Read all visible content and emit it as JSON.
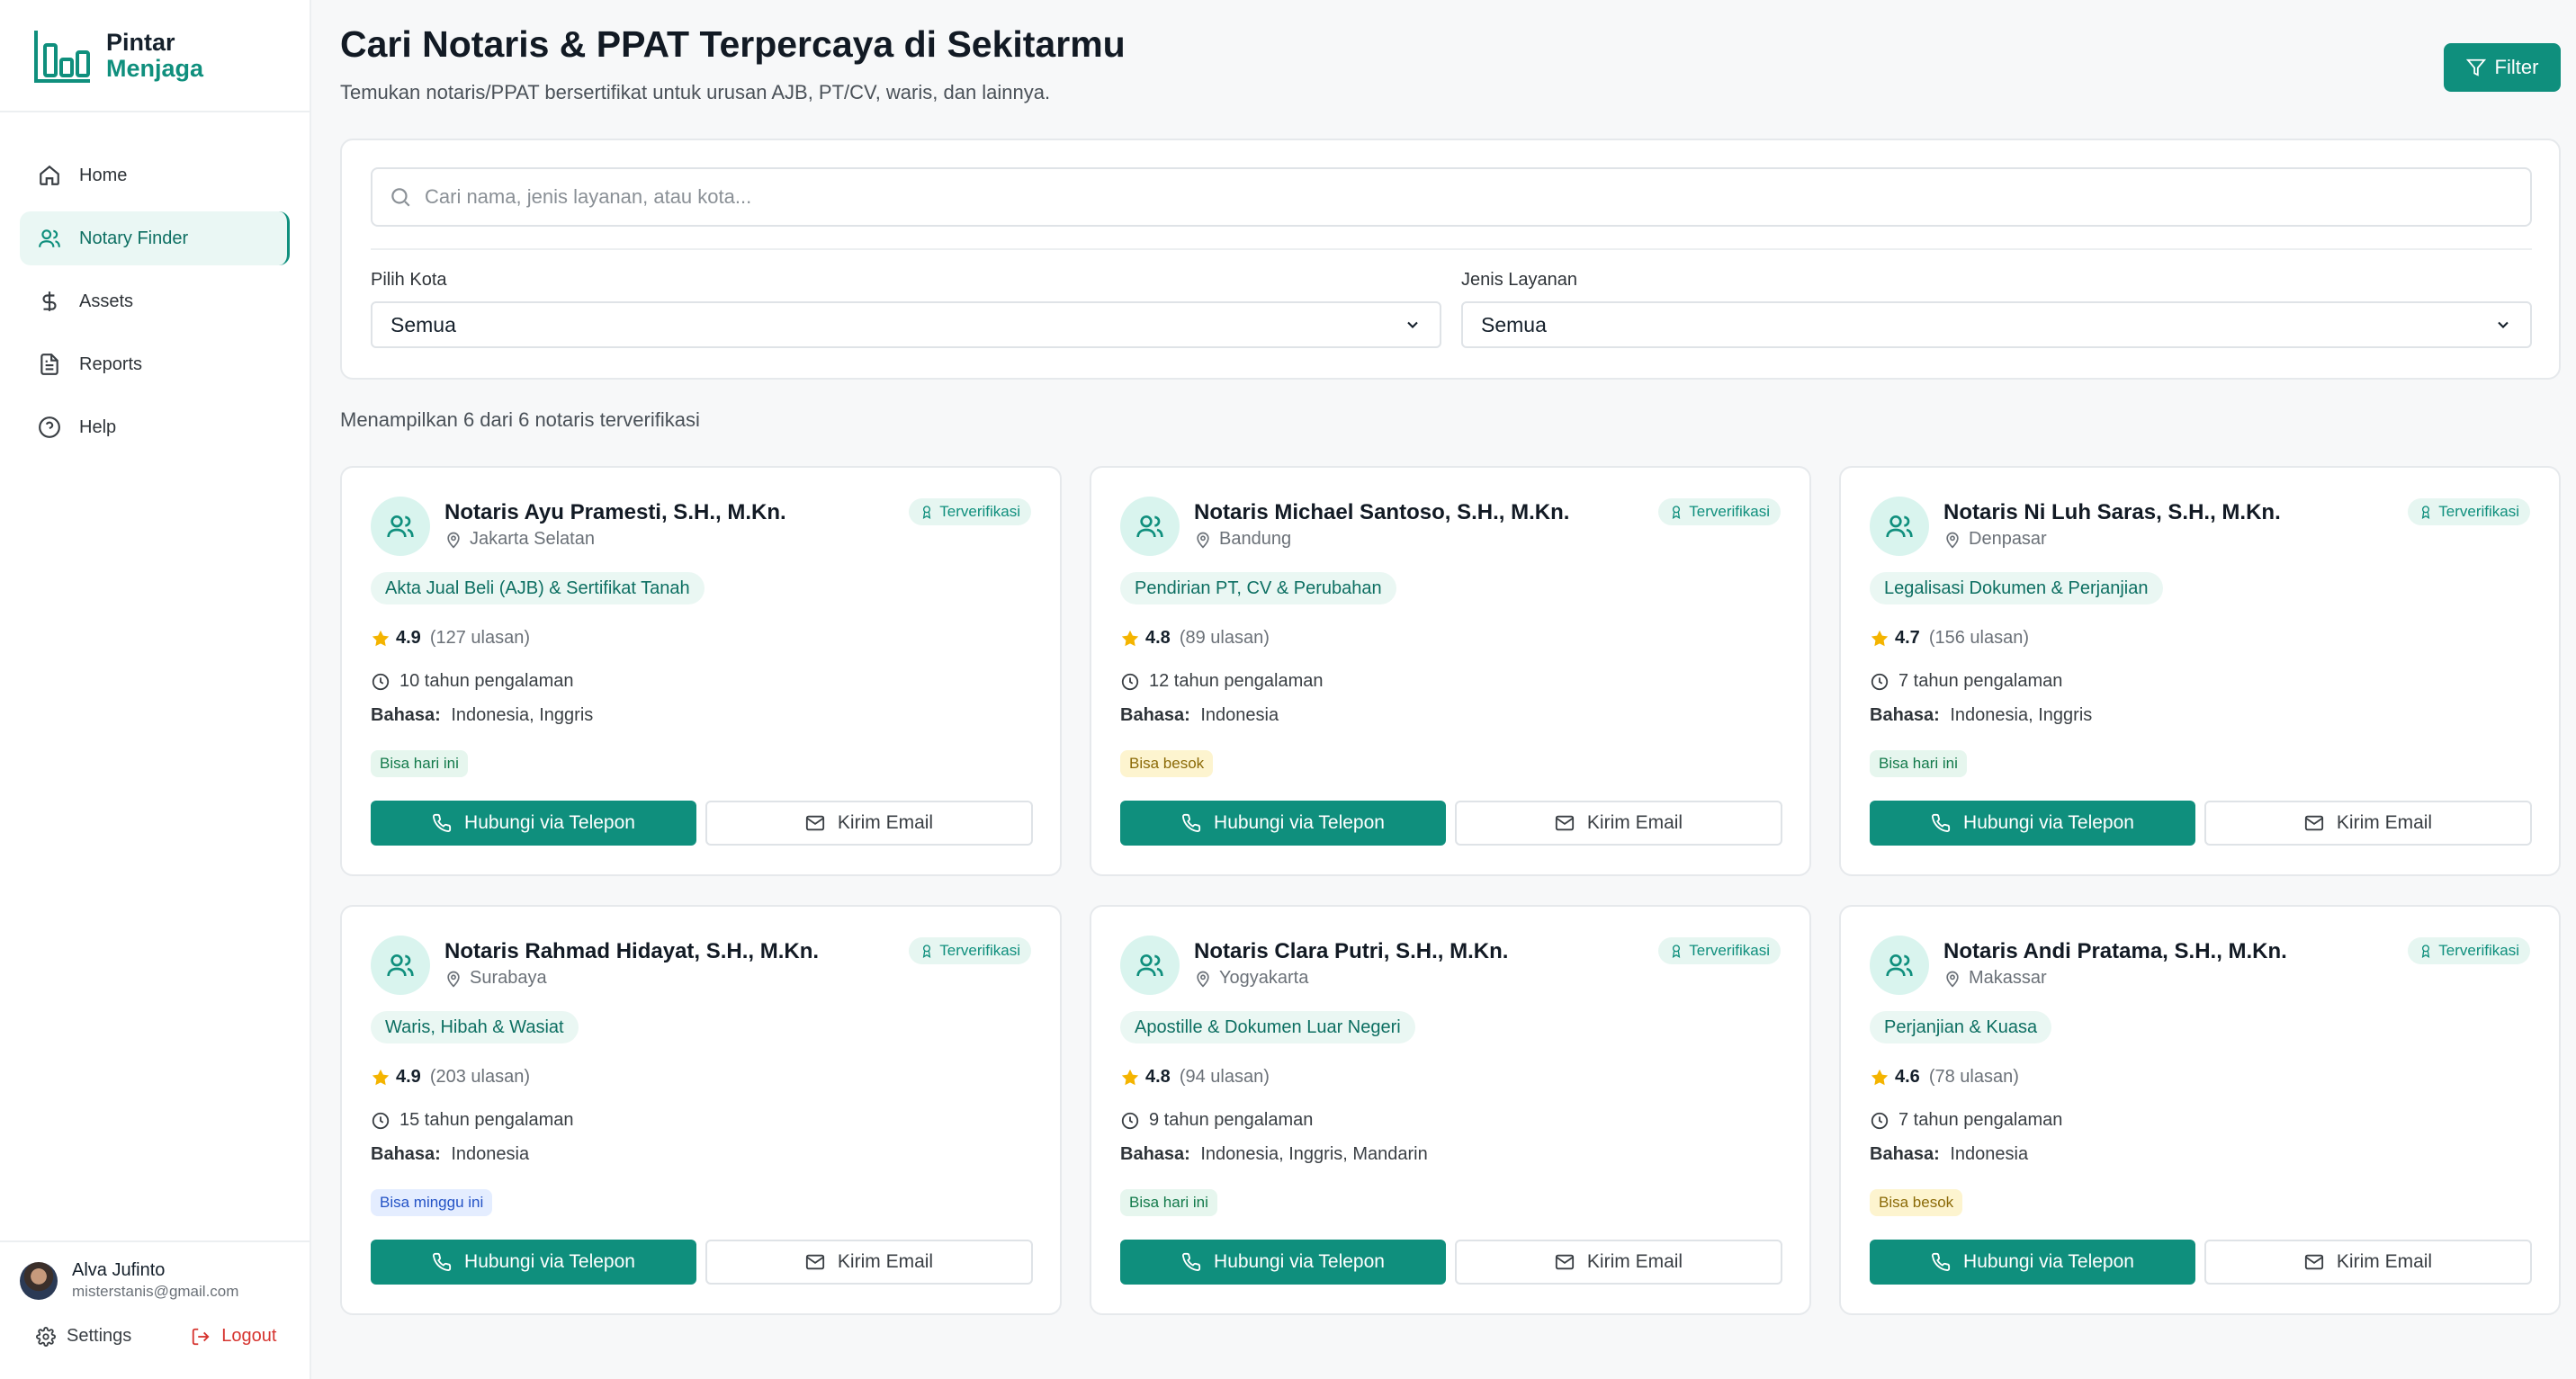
{
  "brand": {
    "line1": "Pintar",
    "line2": "Menjaga",
    "accent": "#0f8f7d"
  },
  "sidebar": {
    "items": [
      {
        "label": "Home",
        "icon": "home-icon"
      },
      {
        "label": "Notary Finder",
        "icon": "users-icon",
        "active": true
      },
      {
        "label": "Assets",
        "icon": "dollar-icon"
      },
      {
        "label": "Reports",
        "icon": "document-icon"
      },
      {
        "label": "Help",
        "icon": "help-circle-icon"
      }
    ],
    "user": {
      "name": "Alva Jufinto",
      "email": "misterstanis@gmail.com"
    },
    "settings_label": "Settings",
    "logout_label": "Logout"
  },
  "header": {
    "title": "Cari Notaris & PPAT Terpercaya di Sekitarmu",
    "subtitle": "Temukan notaris/PPAT bersertifikat untuk urusan AJB, PT/CV, waris, dan lainnya.",
    "filter_label": "Filter"
  },
  "search": {
    "placeholder": "Cari nama, jenis layanan, atau kota...",
    "value": "",
    "city_label": "Pilih Kota",
    "city_value": "Semua",
    "service_label": "Jenis Layanan",
    "service_value": "Semua"
  },
  "results": {
    "summary": "Menampilkan 6 dari 6 notaris terverifikasi"
  },
  "labels": {
    "verified": "Terverifikasi",
    "language": "Bahasa:",
    "call": "Hubungi via Telepon",
    "email": "Kirim Email"
  },
  "notaries": [
    {
      "name": "Notaris Ayu Pramesti, S.H., M.Kn.",
      "city": "Jakarta Selatan",
      "service": "Akta Jual Beli (AJB) & Sertifikat Tanah",
      "rating": "4.9",
      "reviews": "(127 ulasan)",
      "experience": "10 tahun pengalaman",
      "languages": "Indonesia, Inggris",
      "availability": "Bisa hari ini",
      "availability_color": "green"
    },
    {
      "name": "Notaris Michael Santoso, S.H., M.Kn.",
      "city": "Bandung",
      "service": "Pendirian PT, CV & Perubahan",
      "rating": "4.8",
      "reviews": "(89 ulasan)",
      "experience": "12 tahun pengalaman",
      "languages": "Indonesia",
      "availability": "Bisa besok",
      "availability_color": "yellow"
    },
    {
      "name": "Notaris Ni Luh Saras, S.H., M.Kn.",
      "city": "Denpasar",
      "service": "Legalisasi Dokumen & Perjanjian",
      "rating": "4.7",
      "reviews": "(156 ulasan)",
      "experience": "7 tahun pengalaman",
      "languages": "Indonesia, Inggris",
      "availability": "Bisa hari ini",
      "availability_color": "green"
    },
    {
      "name": "Notaris Rahmad Hidayat, S.H., M.Kn.",
      "city": "Surabaya",
      "service": "Waris, Hibah & Wasiat",
      "rating": "4.9",
      "reviews": "(203 ulasan)",
      "experience": "15 tahun pengalaman",
      "languages": "Indonesia",
      "availability": "Bisa minggu ini",
      "availability_color": "blue"
    },
    {
      "name": "Notaris Clara Putri, S.H., M.Kn.",
      "city": "Yogyakarta",
      "service": "Apostille & Dokumen Luar Negeri",
      "rating": "4.8",
      "reviews": "(94 ulasan)",
      "experience": "9 tahun pengalaman",
      "languages": "Indonesia, Inggris, Mandarin",
      "availability": "Bisa hari ini",
      "availability_color": "green"
    },
    {
      "name": "Notaris Andi Pratama, S.H., M.Kn.",
      "city": "Makassar",
      "service": "Perjanjian & Kuasa",
      "rating": "4.6",
      "reviews": "(78 ulasan)",
      "experience": "7 tahun pengalaman",
      "languages": "Indonesia",
      "availability": "Bisa besok",
      "availability_color": "yellow"
    }
  ]
}
